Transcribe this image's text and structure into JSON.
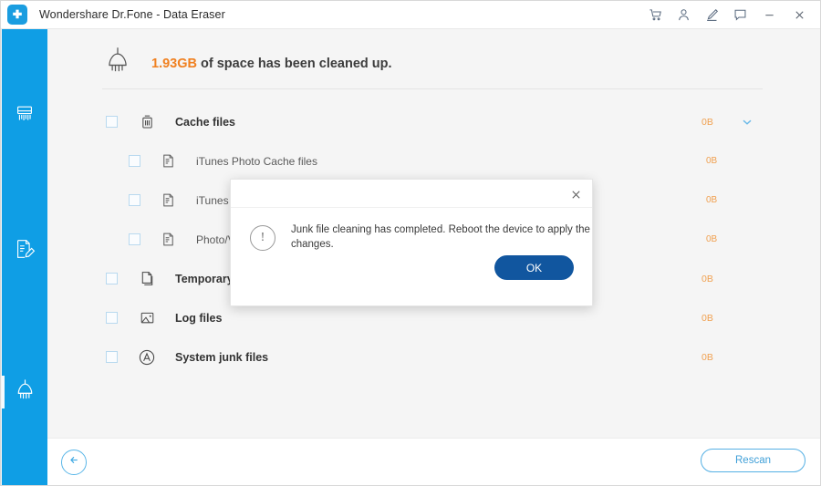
{
  "window": {
    "title": "Wondershare Dr.Fone - Data Eraser",
    "logo_icon": "wondershare-plus-logo",
    "actions": [
      {
        "name": "cart-icon",
        "label": "Cart"
      },
      {
        "name": "account-icon",
        "label": "Account"
      },
      {
        "name": "pen-icon",
        "label": "Feedback"
      },
      {
        "name": "message-icon",
        "label": "Support"
      },
      {
        "name": "minimize-icon",
        "label": "Minimize"
      },
      {
        "name": "close-icon",
        "label": "Close"
      }
    ]
  },
  "sidebar": {
    "background_color": "#0f9ee5",
    "items": [
      {
        "name": "sidebar-item-data-eraser",
        "icon": "shredder-icon",
        "active": false
      },
      {
        "name": "sidebar-item-private-data",
        "icon": "document-pen-icon",
        "active": false
      },
      {
        "name": "sidebar-item-junk-cleaner",
        "icon": "broom-icon",
        "active": true
      }
    ]
  },
  "summary": {
    "icon": "broom-icon",
    "amount": "1.93GB",
    "amount_color": "#f08020",
    "text": " of space has been cleaned up."
  },
  "file_rows": [
    {
      "name": "row-cache-files",
      "label": "Cache files",
      "size": "0B",
      "icon": "trash-icon",
      "sub": false,
      "chevron": "chevron-down-icon"
    },
    {
      "name": "row-itunes-photo-cache",
      "label": "iTunes Photo Cache files",
      "size": "0B",
      "icon": "file-lines-icon",
      "sub": true
    },
    {
      "name": "row-itunes-media",
      "label": "iTunes Medi",
      "size": "0B",
      "icon": "file-lines-icon",
      "sub": true
    },
    {
      "name": "row-photo-video",
      "label": "Photo/Video",
      "size": "0B",
      "icon": "file-lines-icon",
      "sub": true
    },
    {
      "name": "row-temporary-files",
      "label": "Temporary f",
      "size": "0B",
      "icon": "copy-files-icon",
      "sub": false
    },
    {
      "name": "row-log-files",
      "label": "Log files",
      "size": "0B",
      "icon": "image-icon",
      "sub": false
    },
    {
      "name": "row-system-junk-files",
      "label": "System junk files",
      "size": "0B",
      "icon": "circle-a-icon",
      "sub": false
    }
  ],
  "footer": {
    "back_icon": "arrow-left-icon",
    "rescan_label": "Rescan"
  },
  "dialog": {
    "close_icon": "close-icon",
    "warn_icon": "exclamation-circle-icon",
    "message": "Junk file cleaning has completed. Reboot the device to apply the changes.",
    "ok_label": "OK",
    "ok_color": "#11569f"
  }
}
